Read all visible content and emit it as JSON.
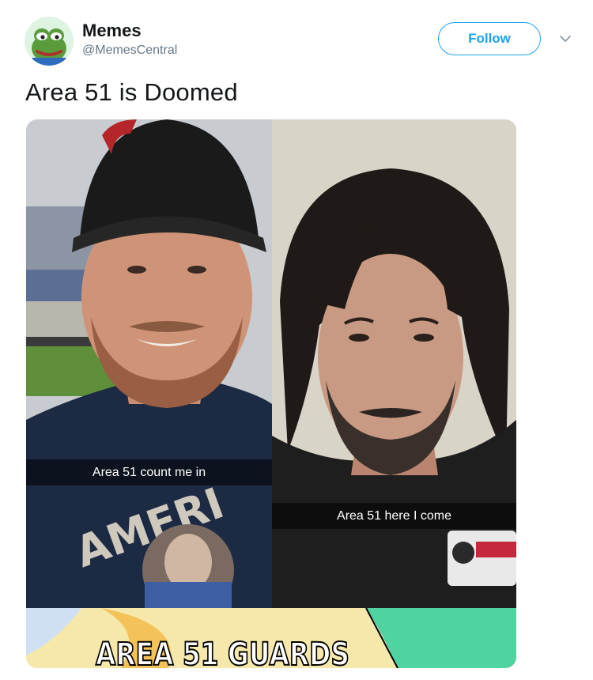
{
  "account": {
    "display_name": "Memes",
    "handle": "@MemesCentral",
    "avatar_icon": "frog-avatar-icon"
  },
  "header": {
    "follow_label": "Follow",
    "menu_icon": "chevron-down-icon"
  },
  "tweet": {
    "text": "Area 51 is Doomed"
  },
  "media": {
    "left_caption": "Area 51 count me in",
    "right_caption": "Area 51 here I come",
    "bottom_caption": "AREA 51 GUARDS"
  },
  "colors": {
    "accent": "#1da1f2",
    "handle_gray": "#657786"
  }
}
